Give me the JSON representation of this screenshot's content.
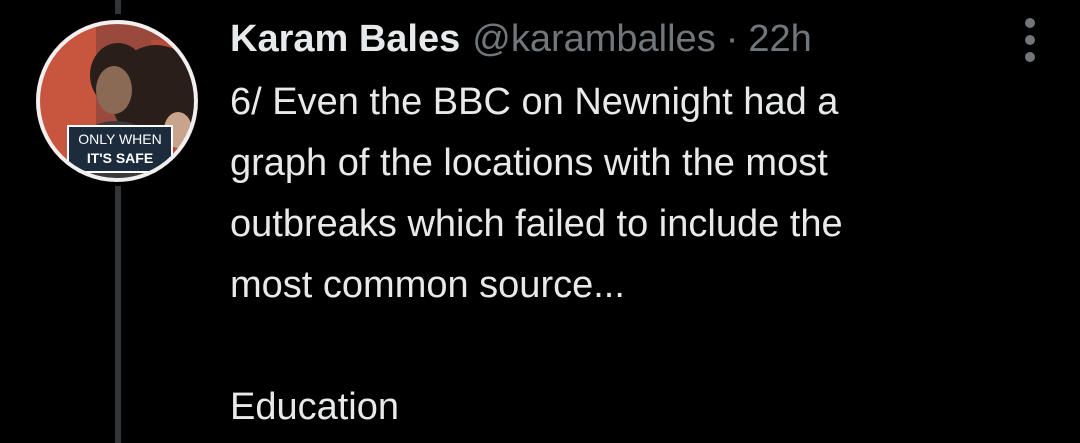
{
  "tweet": {
    "author": {
      "display_name": "Karam Bales",
      "handle": "@karamballes",
      "avatar_caption_line1": "ONLY WHEN",
      "avatar_caption_line2": "IT'S SAFE"
    },
    "separator": "·",
    "time": "22h",
    "text_lines": [
      "6/ Even the BBC on Newnight had a",
      "graph of the locations with the most",
      "outbreaks which failed to include the",
      "most common source..."
    ],
    "text_last": "Education",
    "more_icon": "more-vertical-icon"
  },
  "colors": {
    "background": "#000000",
    "primary_text": "#e7e9ea",
    "secondary_text": "#71767b",
    "thread_line": "#333639"
  }
}
